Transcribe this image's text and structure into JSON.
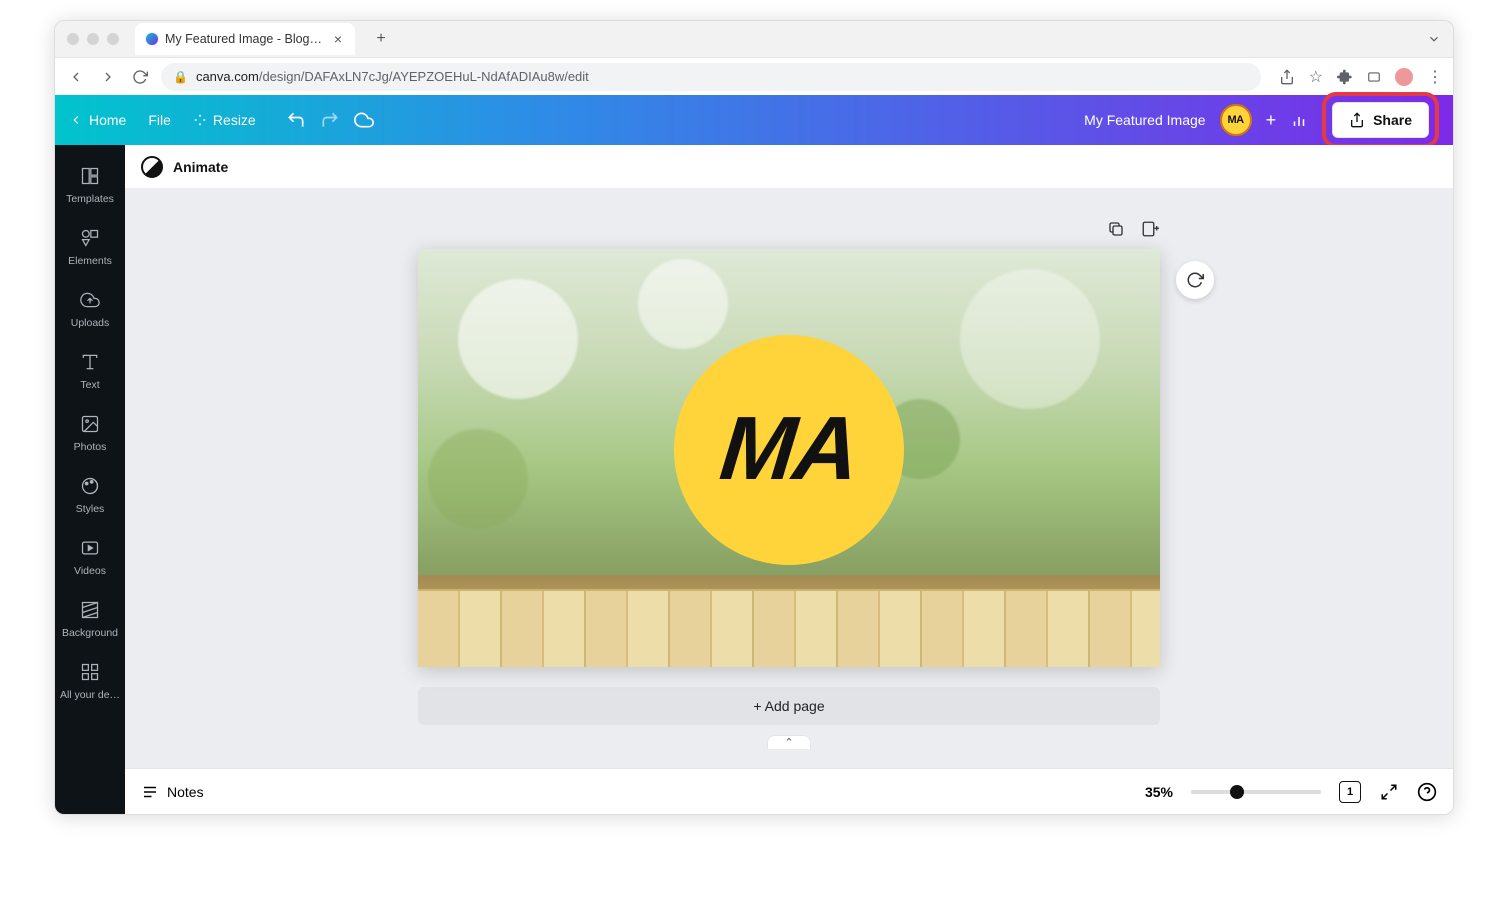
{
  "browser": {
    "tab_title": "My Featured Image - Blog Ban",
    "url_domain": "canva.com",
    "url_path": "/design/DAFAxLN7cJg/AYEPZOEHuL-NdAfADIAu8w/edit"
  },
  "topbar": {
    "home": "Home",
    "file": "File",
    "resize": "Resize",
    "doc_title": "My Featured Image",
    "avatar_initials": "MA",
    "share": "Share"
  },
  "sub_toolbar": {
    "animate": "Animate"
  },
  "sidebar": {
    "items": [
      {
        "label": "Templates",
        "icon": "templates-icon"
      },
      {
        "label": "Elements",
        "icon": "elements-icon"
      },
      {
        "label": "Uploads",
        "icon": "uploads-icon"
      },
      {
        "label": "Text",
        "icon": "text-icon"
      },
      {
        "label": "Photos",
        "icon": "photos-icon"
      },
      {
        "label": "Styles",
        "icon": "styles-icon"
      },
      {
        "label": "Videos",
        "icon": "videos-icon"
      },
      {
        "label": "Background",
        "icon": "background-icon"
      },
      {
        "label": "All your de…",
        "icon": "alldesigns-icon"
      }
    ]
  },
  "canvas": {
    "logo_text": "MA",
    "add_page": "+ Add page"
  },
  "bottombar": {
    "notes": "Notes",
    "zoom": "35%",
    "pages": "1"
  }
}
